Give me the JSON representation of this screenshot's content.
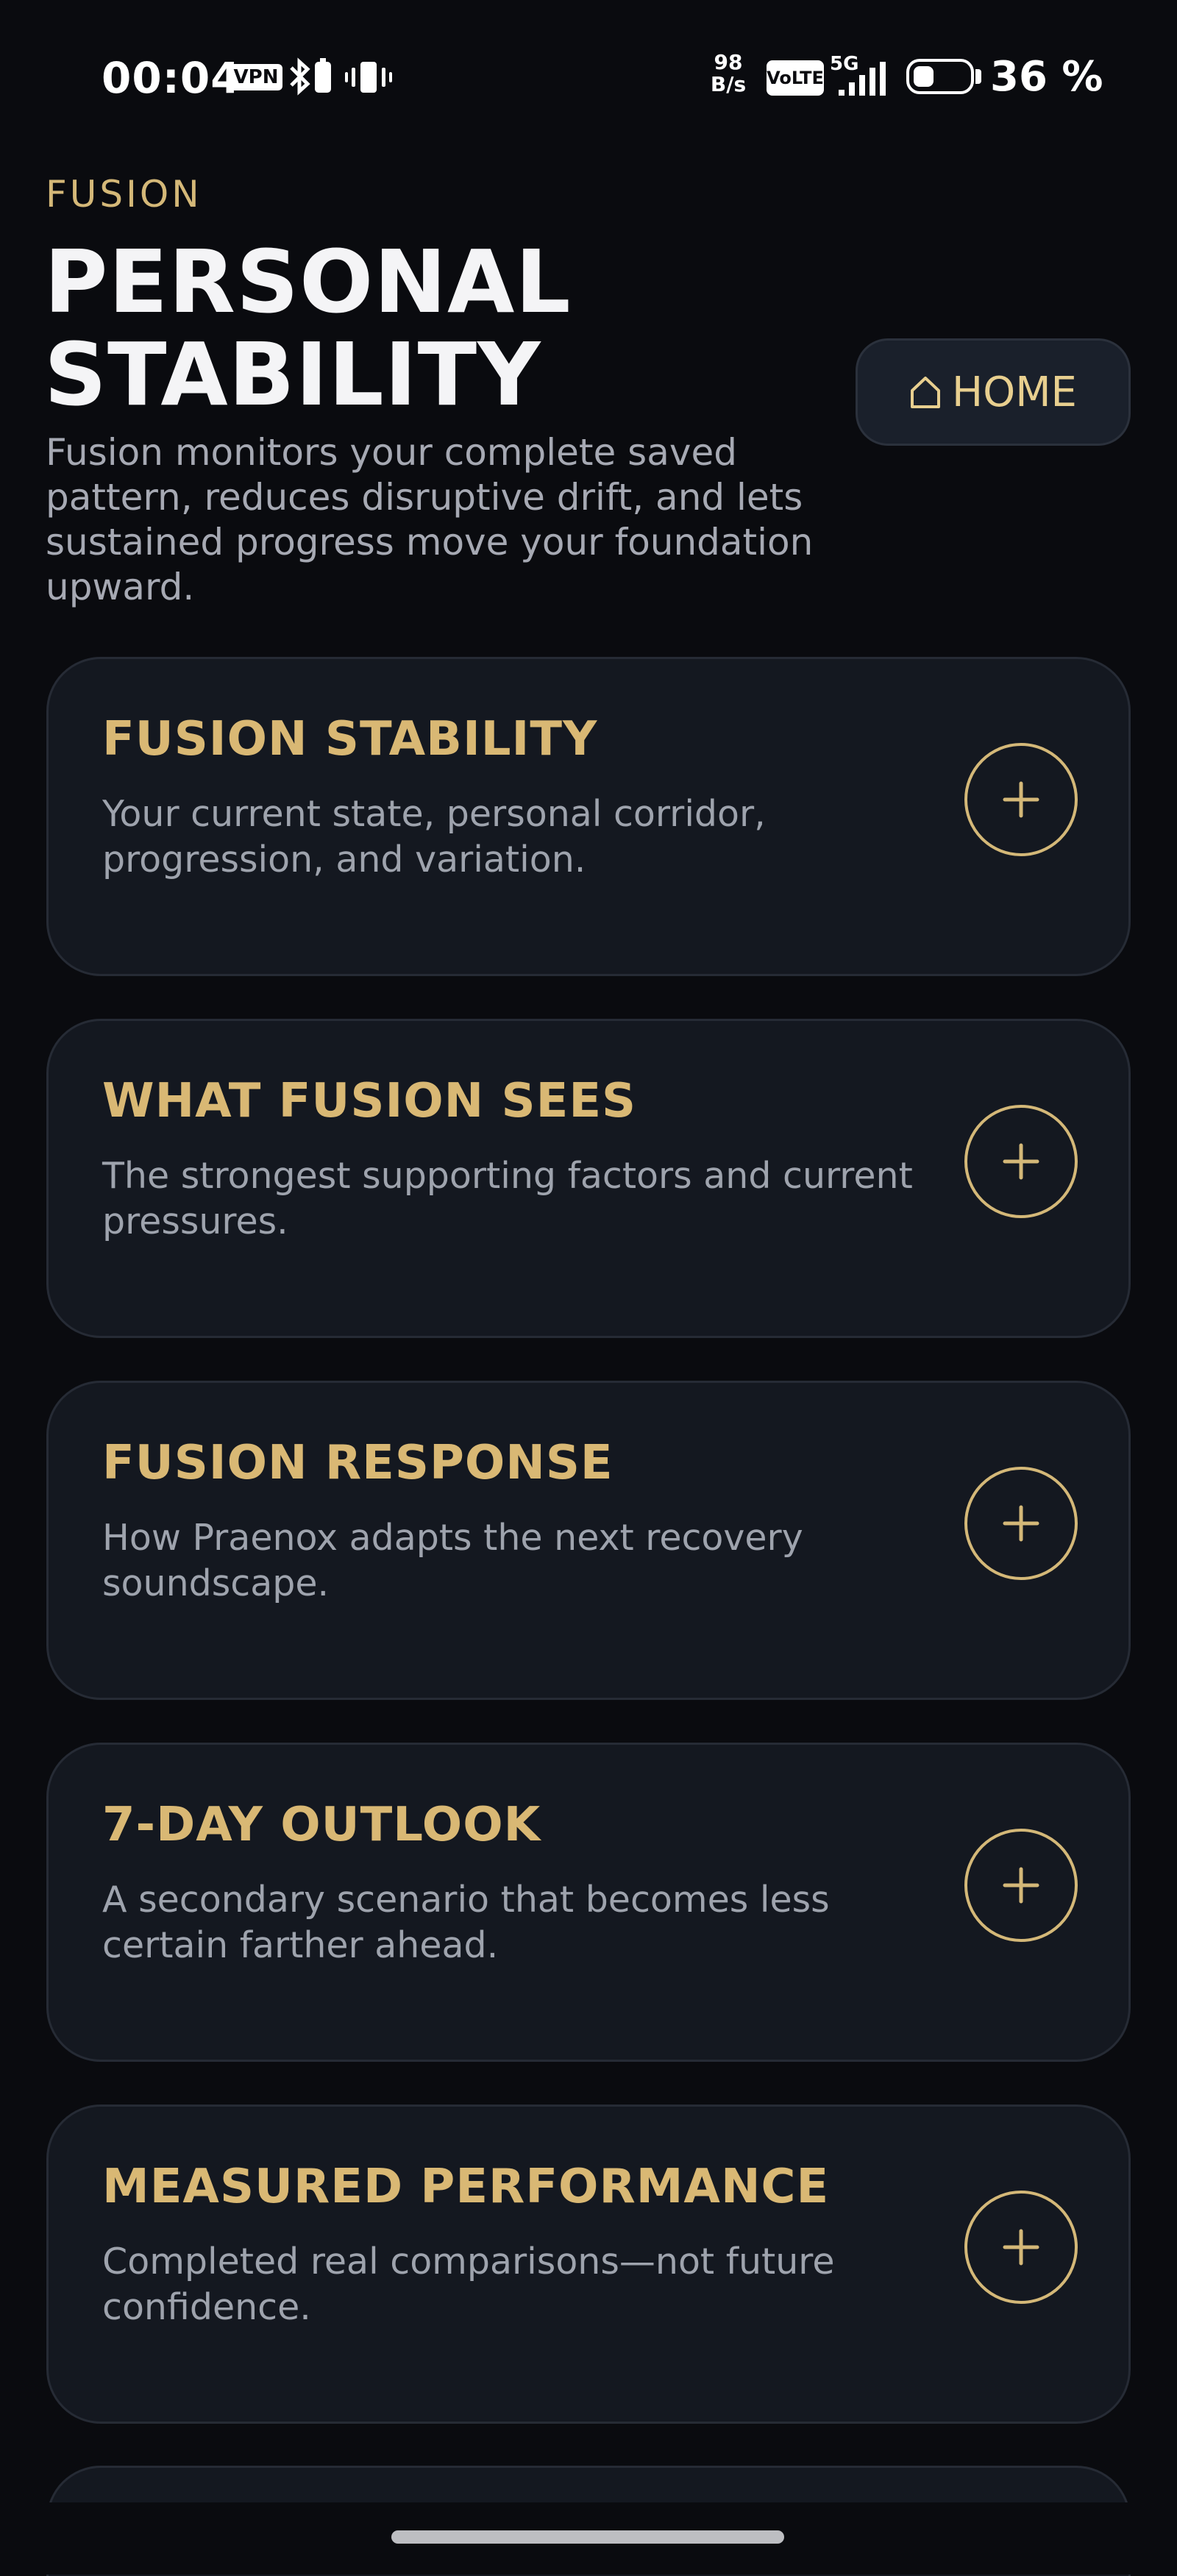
{
  "status_bar": {
    "time": "00:04",
    "vpn": "VPN",
    "speed_value": "98",
    "speed_unit": "B/s",
    "volte": "VoLTE",
    "network": "5G",
    "battery_level": 0.36,
    "battery_percent": "36 %"
  },
  "header": {
    "eyebrow": "FUSION",
    "title": "PERSONAL STABILITY",
    "home_label": "HOME",
    "home_icon": "house-outline-icon",
    "description": "Fusion monitors your complete saved pattern, reduces disruptive drift, and lets sustained progress move your foundation upward."
  },
  "cards": [
    {
      "title": "FUSION STABILITY",
      "text": "Your current state, personal corridor, progression, and variation."
    },
    {
      "title": "WHAT FUSION SEES",
      "text": "The strongest supporting factors and current pressures."
    },
    {
      "title": "FUSION RESPONSE",
      "text": "How Praenox adapts the next recovery soundscape."
    },
    {
      "title": "7-DAY OUTLOOK",
      "text": "A secondary scenario that becomes less certain farther ahead."
    },
    {
      "title": "MEASURED PERFORMANCE",
      "text": "Completed real comparisons—not future confidence."
    }
  ],
  "colors": {
    "background": "#0a0b0f",
    "card": "#141820",
    "accent": "#d4b878",
    "muted_text": "#9ea3ad"
  }
}
